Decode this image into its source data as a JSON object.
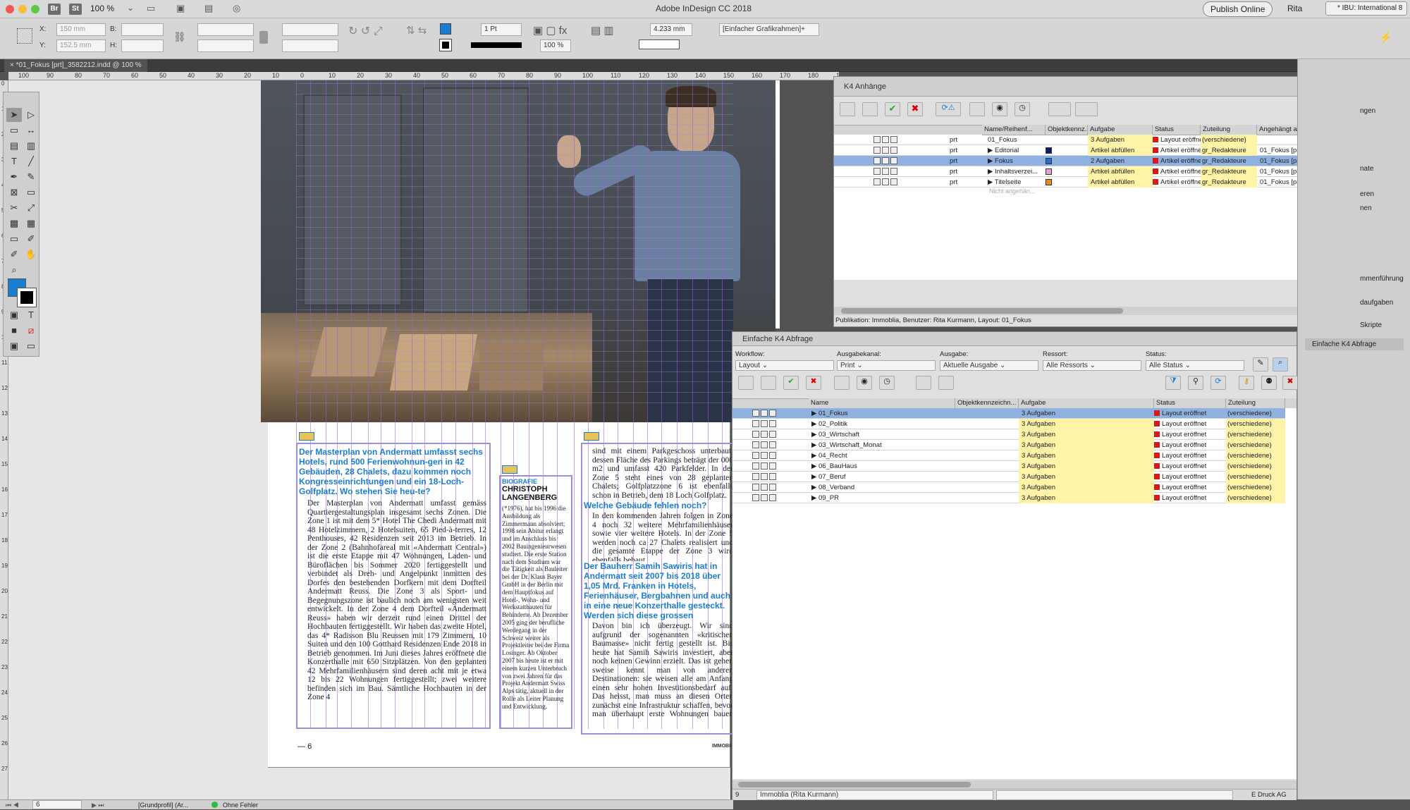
{
  "titlebar": {
    "app_title": "Adobe InDesign CC 2018",
    "zoom": "100 %",
    "publish_btn": "Publish Online",
    "user": "Rita",
    "workspace": "* IBU: International 8",
    "br_label": "Br",
    "st_label": "St"
  },
  "control": {
    "x_label": "X:",
    "x_val": "150 mm",
    "y_label": "Y:",
    "y_val": "152.5 mm",
    "b_label": "B:",
    "h_label": "H:",
    "stroke": "1 Pt",
    "pct": "100 %",
    "ref": "4.233 mm",
    "frame_style": "[Einfacher Grafikrahmen]+"
  },
  "doc_tab": "*01_Fokus [prt]_3582212.indd @ 100 %",
  "ruler": [
    "100",
    "90",
    "80",
    "70",
    "60",
    "50",
    "40",
    "30",
    "20",
    "10",
    "0",
    "10",
    "20",
    "30",
    "40",
    "50",
    "60",
    "70",
    "80",
    "90",
    "100",
    "110",
    "120",
    "130",
    "140",
    "150",
    "160",
    "170",
    "180",
    "190",
    "200",
    "210"
  ],
  "vruler": [
    "0",
    "1",
    "2",
    "3",
    "4",
    "5",
    "6",
    "7",
    "8",
    "9",
    "10",
    "11",
    "12",
    "13",
    "14",
    "15",
    "16",
    "17",
    "18",
    "19",
    "20",
    "21",
    "22",
    "23",
    "24",
    "25",
    "26",
    "27"
  ],
  "article": {
    "heading": "Der Masterplan von Andermatt umfasst sechs Hotels, rund 500 Ferienwohnun-gen in 42 Gebäuden, 28 Chalets, dazu kommen noch Kongresseinrichtungen und ein 18-Loch-Golfplatz. Wo stehen Sie heu-te?",
    "body1": "Der Masterplan von Andermatt umfasst gemäss Quartiergestaltungsplan insgesamt sechs Zonen. Die Zone 1 ist mit dem 5* Hotel The Chedi Andermatt mit 48 Hotelzimmern, 2 Hotelsuiten, 65 Pied-à-terres, 12 Penthouses, 42 Residenzen seit 2013 im Betrieb. In der Zone 2 (Bahnhofareal mit «Andermatt Central») ist die erste Etappe mit 47 Wohnungen, Laden- und Büroflächen bis Sommer 2020 fertiggestellt und verbindet als Dreh- und Angelpunkt inmitten des Dorfes den bestehenden Dorfkern mit dem Dorfteil Andermatt Reuss. Die Zone 3 als Sport- und Begegnungszone ist baulich noch am wenigsten weit entwickelt. In der Zone 4 dem Dorfteil «Andermatt Reuss» haben wir derzeit rund einen Drittel der Hochbauten fertiggestellt. Wir haben das zweite Hotel, das 4* Radisson Blu Reussen mit 179 Zimmern, 10 Suiten und den 100 Gotthard Residenzen Ende 2018 in Betrieb genommen. Im Juni dieses Jahres eröffnete die Konzerthalle mit 650 Sitzplätzen. Von den geplanten 42 Mehrfamilienhäusern sind deren acht mit je etwa 12 bis 22 Wohnungen fertiggestellt; zwei weitere befinden sich im Bau. Sämtliche Hochbauten in der Zone 4",
    "bio_label": "BIOGRAFIE",
    "bio_name": "CHRISTOPH LANGENBERG",
    "bio_text": "(*1976), hat bis 1996 die Ausbildung als Zimmermann absolviert; 1998 sein Abitur erlangt und im Anschluss bis 2002 Bauingenieurwesen studiert. Die erste Station nach dem Studium war die Tätigkeit als Bauleiter bei der Dr. Klaus Bayer GmbH in der Berlin mit dem Hauptfokus auf Hotel-, Wohn- und Werkstattbauten für Behinderte. Ab Dezember 2005 ging der berufliche Werdegang in der Schweiz weiter als Projektleiter bei der Firma Losinger. Ab Oktober 2007 bis heute ist er mit einem kurzen Unterbruch von zwei Jahren für das Projekt Andermatt Swiss Alps tätig, aktuell in der Rolle als Leiter Planung und Entwicklung.",
    "body2a": "sind mit einem Parkgeschoss unterbaut, dessen Fläche des Parkings beträgt der 000 m2 und umfasst 420 Parkfelder. In der Zone 5 steht eines von 28 geplanten Chalets; Golfplatzzone 6 ist ebenfalls schon in Betrieb, dem 18 Loch Golfplatz.",
    "q2": "Welche Gebäude fehlen noch?",
    "body2b": "In den kommenden Jahren folgen in Zone 4 noch 32 weitere Mehrfamilienhäuser sowie vier weitere Hotels. In der Zone 5 werden noch ca 27 Chalets realisiert und die gesamte Etappe der Zone 3 wird ebenfalls bebaut.",
    "q3": "Der Bauherr Samih Sawiris hat in Andermatt seit 2007 bis 2018 über 1,05 Mrd. Franken in Hotels, Ferienhäuser, Bergbahnen und auch in eine neue Konzerthalle gesteckt. Werden sich diese grossen Investitionen eines Tages rechnen?",
    "body2c": "Davon bin ich überzeugt. Wir sind aufgrund der sogenannten «kritischen Baumasse» nicht fertig gestellt ist. Bis heute hat Samih Sawiris investiert, aber noch keinen Gewinn erzielt. Das ist gehen sweise kennt man von anderen Destinationen: sie weisen alle am Anfang einen sehr hohen Investitionsbedarf auf. Das heisst, man muss an diesen Orten zunächst eine Infrastruktur schaffen, bevor man überhaupt erste Wohnungen bauen kann. Ein Beispiel El Gouna, das erste Investition von Samih Sawiris dieser Art, war vorher mit",
    "page_num": "6",
    "footer_right": "IMMOBILIA"
  },
  "k4anh": {
    "title": "K4 Anhänge",
    "headers": [
      "Name/Reihenf...",
      "Objektkennz...",
      "Aufgabe",
      "Status",
      "Zuteilung",
      "Angehängt an",
      "Platzier"
    ],
    "rows": [
      {
        "kind": "prt",
        "name": "01_Fokus",
        "task": "3 Aufgaben",
        "status": "Layout eröffnet",
        "assign": "(verschiedene)",
        "attached": "",
        "place": "",
        "swatch": ""
      },
      {
        "kind": "prt",
        "name": "Editorial",
        "task": "Artikel abfüllen",
        "status": "Artikel eröffnet",
        "assign": "gr_Redakteure",
        "attached": "01_Fokus [prt]",
        "place": "01_Foku",
        "swatch": "#0a1a7a"
      },
      {
        "kind": "prt",
        "name": "Fokus",
        "task": "2 Aufgaben",
        "status": "Artikel eröffnet",
        "assign": "gr_Redakteure",
        "attached": "01_Fokus [prt]",
        "place": "01_Foku",
        "swatch": "#2a6ad8"
      },
      {
        "kind": "prt",
        "name": "Inhaltsverzei...",
        "task": "Artikel abfüllen",
        "status": "Artikel eröffnet",
        "assign": "gr_Redakteure",
        "attached": "01_Fokus [prt]",
        "place": "01_Foku",
        "swatch": "#e79ed7"
      },
      {
        "kind": "prt",
        "name": "Titelseite",
        "task": "Artikel abfüllen",
        "status": "Artikel eröffnet",
        "assign": "gr_Redakteure",
        "attached": "01_Fokus [prt]",
        "place": "01_Foku",
        "swatch": "#ee8a10"
      }
    ],
    "placeholder": "Nicht angehän...",
    "footer": "Publikation: Immoblia, Benutzer: Rita Kurmann, Layout: 01_Fokus"
  },
  "k4abf": {
    "title": "Einfache K4 Abfrage",
    "filters": [
      {
        "label": "Workflow:",
        "value": "Layout"
      },
      {
        "label": "Ausgabekanal:",
        "value": "Print"
      },
      {
        "label": "Ausgabe:",
        "value": "Aktuelle Ausgabe"
      },
      {
        "label": "Ressort:",
        "value": "Alle Ressorts"
      },
      {
        "label": "Status:",
        "value": "Alle Status"
      }
    ],
    "headers": [
      "Name",
      "Objektkennzeichn...",
      "Aufgabe",
      "Status",
      "Zuteilung"
    ],
    "rows": [
      {
        "name": "01_Fokus",
        "task": "3 Aufgaben",
        "status": "Layout eröffnet",
        "assign": "(verschiedene)"
      },
      {
        "name": "02_Politik",
        "task": "3 Aufgaben",
        "status": "Layout eröffnet",
        "assign": "(verschiedene)"
      },
      {
        "name": "03_Wirtschaft",
        "task": "3 Aufgaben",
        "status": "Layout eröffnet",
        "assign": "(verschiedene)"
      },
      {
        "name": "03_Wirtschaft_Monat",
        "task": "3 Aufgaben",
        "status": "Layout eröffnet",
        "assign": "(verschiedene)"
      },
      {
        "name": "04_Recht",
        "task": "3 Aufgaben",
        "status": "Layout eröffnet",
        "assign": "(verschiedene)"
      },
      {
        "name": "06_BauHaus",
        "task": "3 Aufgaben",
        "status": "Layout eröffnet",
        "assign": "(verschiedene)"
      },
      {
        "name": "07_Beruf",
        "task": "3 Aufgaben",
        "status": "Layout eröffnet",
        "assign": "(verschiedene)"
      },
      {
        "name": "08_Verband",
        "task": "3 Aufgaben",
        "status": "Layout eröffnet",
        "assign": "(verschiedene)"
      },
      {
        "name": "09_PR",
        "task": "3 Aufgaben",
        "status": "Layout eröffnet",
        "assign": "(verschiedene)"
      }
    ],
    "count": "9",
    "user_sel": "Immoblia (Rita Kurmann)",
    "footer_right": "E Druck AG"
  },
  "rightpanel": [
    "ngen",
    "nate",
    "eren",
    "nen",
    "mmenführung",
    "daufgaben",
    "Skripte",
    "Einfache K4 Abfrage"
  ],
  "status": {
    "page": "6",
    "master": "[Grundprofil] (Ar...",
    "errors": "Ohne Fehler"
  }
}
